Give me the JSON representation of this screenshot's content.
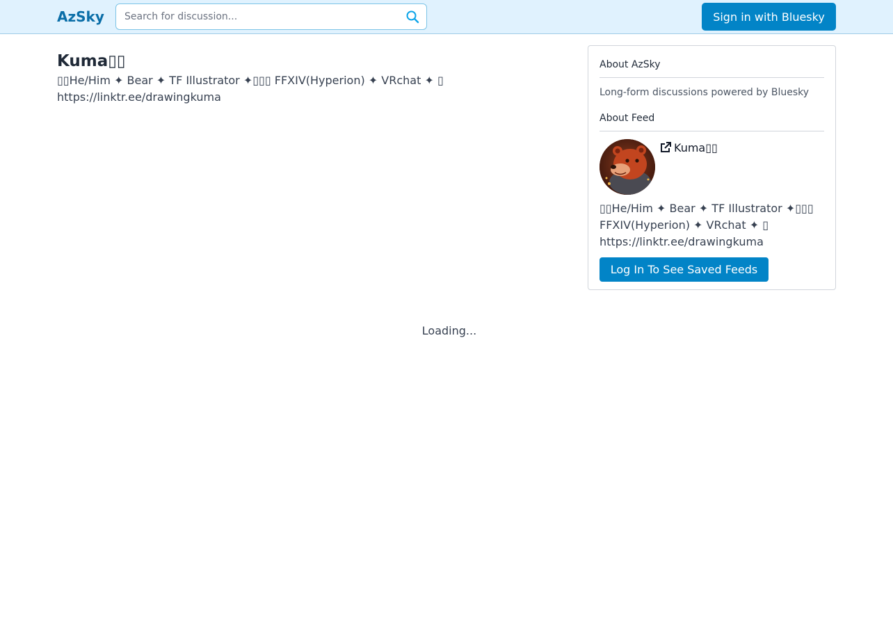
{
  "header": {
    "brand": "AzSky",
    "search": {
      "placeholder": "Search for discussion...",
      "value": ""
    },
    "signin_label": "Sign in with Bluesky"
  },
  "profile": {
    "title": "Kuma▯▯",
    "description": "▯▯He/Him ✦ Bear ✦ TF Illustrator ✦▯▯▯ FFXIV(Hyperion) ✦ VRchat ✦ ▯\nhttps://linktr.ee/drawingkuma"
  },
  "sidebar": {
    "about_azsky_heading": "About AzSky",
    "tagline": "Long-form discussions powered by Bluesky",
    "about_feed_heading": "About Feed",
    "feed_name": "Kuma▯▯",
    "feed_description": "▯▯He/Him ✦ Bear ✦ TF Illustrator ✦▯▯▯ FFXIV(Hyperion) ✦ VRchat ✦ ▯ https://linktr.ee/drawingkuma",
    "login_label": "Log In To See Saved Feeds",
    "icons": {
      "feed_link": "external-link-icon",
      "avatar": "bear-avatar"
    }
  },
  "main": {
    "loading_text": "Loading..."
  },
  "colors": {
    "accent": "#0284c7",
    "brand": "#0a6ea8",
    "navbar_bg": "#e0f2fe"
  }
}
